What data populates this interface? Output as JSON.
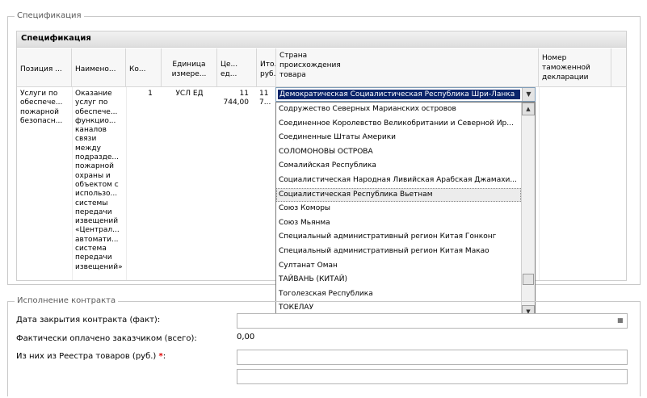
{
  "spec_fieldset": {
    "legend": "Спецификация"
  },
  "grid": {
    "title": "Спецификация",
    "columns": [
      "Позиция ...",
      "Наимено...",
      "Ко...",
      "Единица измере...",
      "Це... ед...",
      "Ито... руб...",
      "Страна происхождения товара",
      "Номер таможенной декларации"
    ],
    "row": {
      "position": "Услуги по обеспече... пожарной безопасн...",
      "name": "Оказание услуг по обеспече... функцио... каналов связи между подразде... пожарной охраны и объектом с использо... системы передачи извещений «Централ... автомати... система передачи извещений»",
      "quantity": "1",
      "unit": "УСЛ ЕД",
      "price": "11 744,00",
      "total": "11 7..."
    }
  },
  "country_dropdown": {
    "selected": "Демократическая Социалистическая Республика Шри-Ланка",
    "options": [
      "Содружество Северных Марианских островов",
      "Соединенное Королевство Великобритании и Северной Ир...",
      "Соединенные Штаты Америки",
      "СОЛОМОНОВЫ ОСТРОВА",
      "Сомалийская Республика",
      "Социалистическая Народная Ливийская Арабская Джамахи...",
      "Социалистическая Республика Вьетнам",
      "Союз Коморы",
      "Союз Мьянма",
      "Специальный административный регион Китая Гонконг",
      "Специальный административный регион Китая Макао",
      "Султанат Оман",
      "ТАЙВАНЬ (КИТАЙ)",
      "Тоголезская Республика",
      "ТОКЕЛАУ"
    ],
    "highlighted": "Социалистическая Республика Вьетнам"
  },
  "contract_fieldset": {
    "legend": "Исполнение контракта",
    "close_date_label": "Дата закрытия контракта (факт):",
    "paid_label": "Фактически оплачено заказчиком (всего):",
    "paid_value": "0,00",
    "registry_label": "Из них из Реестра товаров (руб.)",
    "required_mark": "*",
    "colon": ":"
  },
  "icons": {
    "dropdown": "chevron-down-icon",
    "calendar": "calendar-icon",
    "scroll_up": "scroll-up-icon",
    "scroll_down": "scroll-down-icon"
  },
  "colors": {
    "selection": "#0a246a",
    "required": "#e00000"
  }
}
